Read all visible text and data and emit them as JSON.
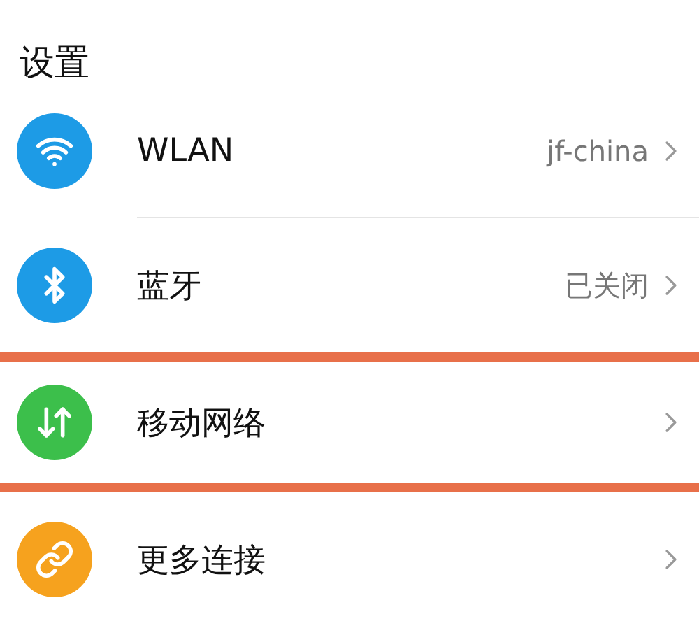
{
  "title": "设置",
  "items": [
    {
      "kind": "wifi",
      "label": "WLAN",
      "value": "jf-china",
      "color": "#1d9be6",
      "highlighted": false
    },
    {
      "kind": "bluetooth",
      "label": "蓝牙",
      "value": "已关闭",
      "color": "#1d9be6",
      "highlighted": false
    },
    {
      "kind": "mobile",
      "label": "移动网络",
      "color": "#3cbf4b",
      "highlighted": true
    },
    {
      "kind": "link",
      "label": "更多连接",
      "color": "#f6a21e",
      "highlighted": false
    }
  ]
}
